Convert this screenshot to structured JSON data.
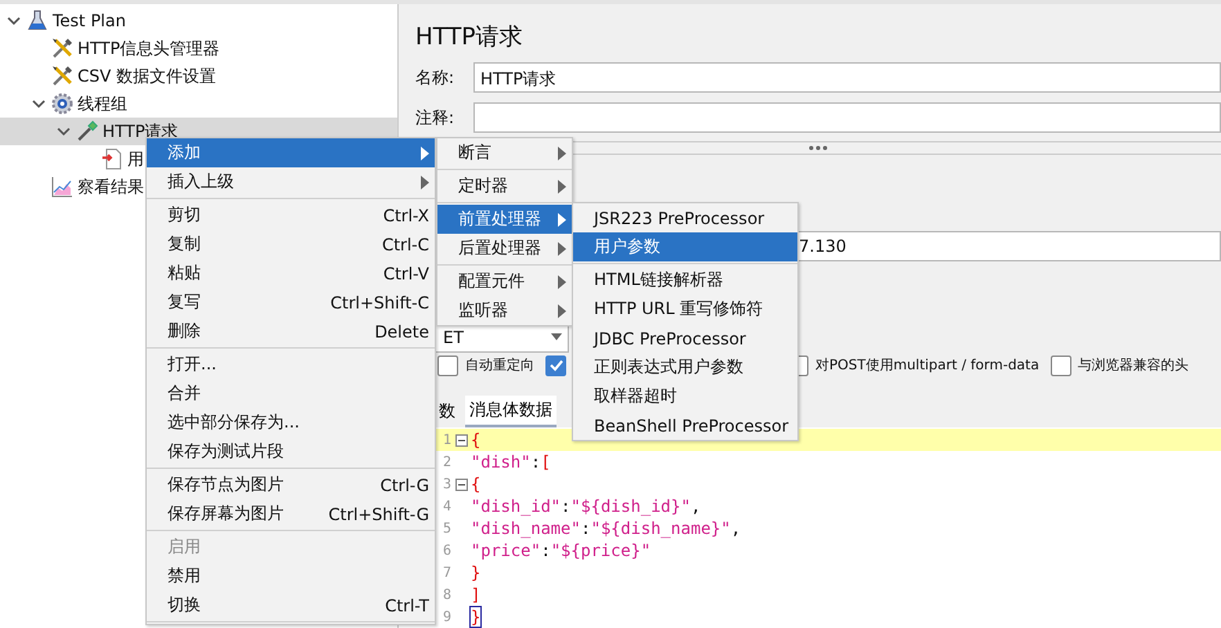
{
  "tree": [
    {
      "label": "Test Plan",
      "kind": "flask",
      "selected": false,
      "expanded": true,
      "children": [
        {
          "label": "HTTP信息头管理器",
          "kind": "tools",
          "selected": false
        },
        {
          "label": "CSV 数据文件设置",
          "kind": "tools",
          "selected": false
        },
        {
          "label": "线程组",
          "kind": "gear",
          "selected": false,
          "expanded": true,
          "children": [
            {
              "label": "HTTP请求",
              "kind": "dropper",
              "selected": true,
              "expanded": true,
              "children": [
                {
                  "label": "用",
                  "kind": "document",
                  "selected": false
                }
              ]
            }
          ]
        },
        {
          "label": "察看结果",
          "kind": "chart",
          "selected": false
        }
      ]
    }
  ],
  "panel": {
    "title": "HTTP请求",
    "name_field": {
      "label": "名称:",
      "value": "HTTP请求"
    },
    "comment_field": {
      "label": "注释:"
    },
    "server_field": {
      "value": "7.130"
    },
    "method_combo": {
      "value": "ET"
    },
    "checkboxes": [
      {
        "label": "自动重定向",
        "checked": false
      },
      {
        "checked": true
      },
      {
        "label": "对POST使用multipart / form-data",
        "checked": false
      },
      {
        "label": "与浏览器兼容的头",
        "checked": false
      }
    ],
    "tabs": [
      {
        "label": "数",
        "selected": false
      },
      {
        "label": "消息体数据",
        "selected": true
      }
    ],
    "code_lines": [
      {
        "number": "1",
        "text": "{",
        "fold": true,
        "current": true,
        "bracket_match": false
      },
      {
        "number": "2",
        "text": "\"dish\":[",
        "fold": false,
        "current": false,
        "bracket_match": false
      },
      {
        "number": "3",
        "text": "{",
        "fold": true,
        "current": false,
        "bracket_match": false
      },
      {
        "number": "4",
        "text": "\"dish_id\":\"${dish_id}\",",
        "fold": false,
        "current": false,
        "bracket_match": false
      },
      {
        "number": "5",
        "text": "\"dish_name\":\"${dish_name}\",",
        "fold": false,
        "current": false,
        "bracket_match": false
      },
      {
        "number": "6",
        "text": "\"price\":\"${price}\"",
        "fold": false,
        "current": false,
        "bracket_match": false
      },
      {
        "number": "7",
        "text": "}",
        "fold": false,
        "current": false,
        "bracket_match": false
      },
      {
        "number": "8",
        "text": "]",
        "fold": false,
        "current": false,
        "bracket_match": false
      },
      {
        "number": "9",
        "text": "}",
        "fold": false,
        "current": false,
        "bracket_match": true
      }
    ]
  },
  "context_menu": [
    {
      "kind": "submenu",
      "label": "添加",
      "selected": true,
      "disabled": false
    },
    {
      "kind": "submenu",
      "label": "插入上级",
      "selected": false,
      "disabled": false
    },
    {
      "kind": "separator"
    },
    {
      "kind": "item",
      "label": "剪切",
      "shortcut": "Ctrl-X",
      "selected": false,
      "disabled": false
    },
    {
      "kind": "item",
      "label": "复制",
      "shortcut": "Ctrl-C",
      "selected": false,
      "disabled": false
    },
    {
      "kind": "item",
      "label": "粘贴",
      "shortcut": "Ctrl-V",
      "selected": false,
      "disabled": false
    },
    {
      "kind": "item",
      "label": "复写",
      "shortcut": "Ctrl+Shift-C",
      "selected": false,
      "disabled": false
    },
    {
      "kind": "item",
      "label": "删除",
      "shortcut": "Delete",
      "selected": false,
      "disabled": false
    },
    {
      "kind": "separator"
    },
    {
      "kind": "item",
      "label": "打开...",
      "selected": false,
      "disabled": false
    },
    {
      "kind": "item",
      "label": "合并",
      "selected": false,
      "disabled": false
    },
    {
      "kind": "item",
      "label": "选中部分保存为...",
      "selected": false,
      "disabled": false
    },
    {
      "kind": "item",
      "label": "保存为测试片段",
      "selected": false,
      "disabled": false
    },
    {
      "kind": "separator"
    },
    {
      "kind": "item",
      "label": "保存节点为图片",
      "shortcut": "Ctrl-G",
      "selected": false,
      "disabled": false
    },
    {
      "kind": "item",
      "label": "保存屏幕为图片",
      "shortcut": "Ctrl+Shift-G",
      "selected": false,
      "disabled": false
    },
    {
      "kind": "separator"
    },
    {
      "kind": "item",
      "label": "启用",
      "selected": false,
      "disabled": true
    },
    {
      "kind": "item",
      "label": "禁用",
      "selected": false,
      "disabled": false
    },
    {
      "kind": "item",
      "label": "切换",
      "shortcut": "Ctrl-T",
      "selected": false,
      "disabled": false
    },
    {
      "kind": "separator"
    }
  ],
  "add_submenu": [
    {
      "kind": "submenu",
      "label": "断言",
      "selected": false,
      "disabled": false
    },
    {
      "kind": "separator"
    },
    {
      "kind": "submenu",
      "label": "定时器",
      "selected": false,
      "disabled": false
    },
    {
      "kind": "separator"
    },
    {
      "kind": "submenu",
      "label": "前置处理器",
      "selected": true,
      "disabled": false
    },
    {
      "kind": "submenu",
      "label": "后置处理器",
      "selected": false,
      "disabled": false
    },
    {
      "kind": "separator"
    },
    {
      "kind": "submenu",
      "label": "配置元件",
      "selected": false,
      "disabled": false
    },
    {
      "kind": "submenu",
      "label": "监听器",
      "selected": false,
      "disabled": false
    }
  ],
  "preprocessor_submenu": [
    {
      "kind": "item",
      "label": "JSR223 PreProcessor",
      "selected": false,
      "disabled": false
    },
    {
      "kind": "item",
      "label": "用户参数",
      "selected": true,
      "disabled": false
    },
    {
      "kind": "separator"
    },
    {
      "kind": "item",
      "label": "HTML链接解析器",
      "selected": false,
      "disabled": false
    },
    {
      "kind": "item",
      "label": "HTTP URL 重写修饰符",
      "selected": false,
      "disabled": false
    },
    {
      "kind": "item",
      "label": "JDBC PreProcessor",
      "selected": false,
      "disabled": false
    },
    {
      "kind": "item",
      "label": "正则表达式用户参数",
      "selected": false,
      "disabled": false
    },
    {
      "kind": "item",
      "label": "取样器超时",
      "selected": false,
      "disabled": false
    },
    {
      "kind": "item",
      "label": "BeanShell PreProcessor",
      "selected": false,
      "disabled": false
    }
  ]
}
